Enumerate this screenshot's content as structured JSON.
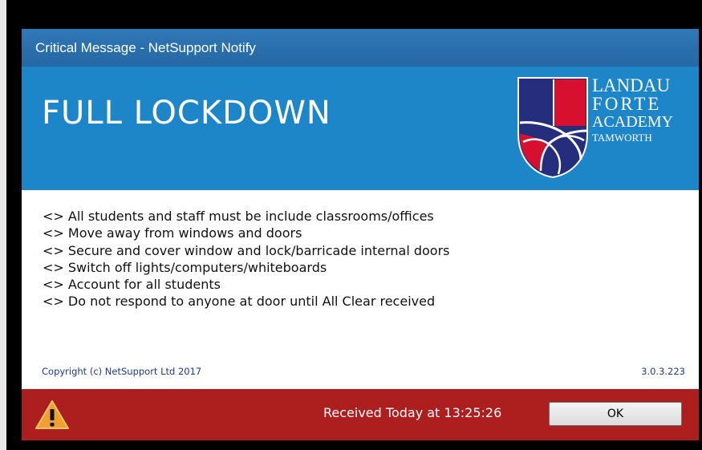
{
  "window": {
    "title": "Critical Message - NetSupport Notify"
  },
  "banner": {
    "title": "FULL LOCKDOWN",
    "logo": {
      "lines": [
        "LANDAU",
        "FORTE",
        "ACADEMY",
        "TAMWORTH"
      ]
    }
  },
  "message": {
    "lines": [
      "<> All students and staff must be include classrooms/offices",
      "<> Move away from windows and doors",
      "<> Secure and cover window and lock/barricade internal doors",
      "<> Switch off lights/computers/whiteboards",
      "<> Account for all students",
      "<> Do not respond to anyone at door until All Clear received"
    ]
  },
  "info": {
    "copyright": "Copyright (c) NetSupport Ltd 2017",
    "version": "3.0.3.223"
  },
  "footer": {
    "received": "Received Today at 13:25:26",
    "ok_label": "OK",
    "icon": "warning-icon"
  },
  "colors": {
    "titlebar": "#2a6fae",
    "banner": "#1d86c8",
    "footer": "#ad1e1e",
    "logo_navy": "#252e7c",
    "logo_red": "#d8102f",
    "warning": "#f0a030"
  }
}
